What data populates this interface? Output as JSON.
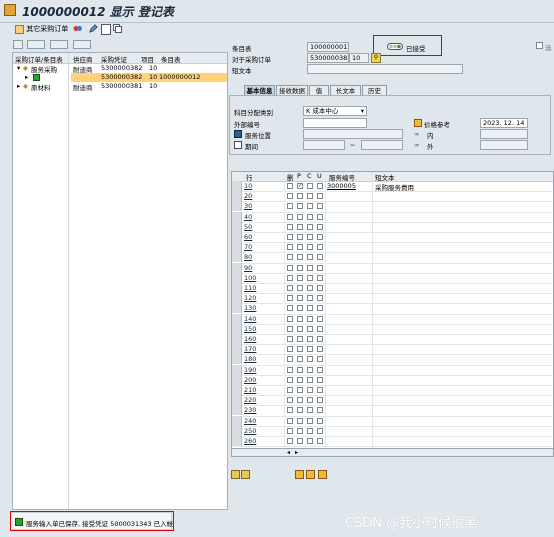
{
  "window": {
    "title": "1000000012 显示 登记表"
  },
  "toolbar": {
    "other_po_label": "其它采购订单"
  },
  "tree": {
    "columns": [
      "采购订单/条目表",
      "供应商",
      "采购凭证",
      "项目",
      "条目表"
    ],
    "rows": [
      {
        "label": "服务采购",
        "vendor": "耐迪商",
        "doc": "5300000382",
        "item": "10",
        "entry": "",
        "selected": false
      },
      {
        "label": "",
        "vendor": "",
        "doc": "5300000382",
        "item": "10",
        "entry": "1000000012",
        "selected": true
      },
      {
        "label": "原材料",
        "vendor": "耐迪商",
        "doc": "5300000381",
        "item": "10",
        "entry": "",
        "selected": false
      }
    ]
  },
  "header": {
    "entry_label": "条目表",
    "entry_value": "1000000012",
    "status_label": "已接受",
    "po_label": "对于采购订单",
    "po_value": "5300000382",
    "po_item": "10",
    "short_text_label": "短文本",
    "short_text_value": "",
    "right_edge_label": "选"
  },
  "tabs": [
    "基本信息",
    "接收数据",
    "值",
    "长文本",
    "历史"
  ],
  "basic": {
    "acct_label": "科目分配类别",
    "acct_value": "K 成本中心",
    "ext_no_label": "外部编号",
    "ext_no_value": "",
    "price_ref_label": "价格参考",
    "price_ref_value": "2023. 12. 14",
    "location_label": "服务位置",
    "location_value": "",
    "inner_label": "内",
    "period_label": "期间",
    "period_sep": "~",
    "outer_label": "外"
  },
  "grid": {
    "columns": [
      "行",
      "删",
      "P",
      "C",
      "U",
      "服务编号",
      "短文本"
    ],
    "rows": [
      {
        "line": "10",
        "service_no": "3000005",
        "text": "采购服务费用",
        "p": true
      },
      {
        "line": "20",
        "service_no": "",
        "text": "",
        "p": false
      },
      {
        "line": "30",
        "service_no": "",
        "text": "",
        "p": false
      },
      {
        "line": "40",
        "service_no": "",
        "text": "",
        "p": false
      },
      {
        "line": "50",
        "service_no": "",
        "text": "",
        "p": false
      },
      {
        "line": "60",
        "service_no": "",
        "text": "",
        "p": false
      },
      {
        "line": "70",
        "service_no": "",
        "text": "",
        "p": false
      },
      {
        "line": "80",
        "service_no": "",
        "text": "",
        "p": false
      },
      {
        "line": "90",
        "service_no": "",
        "text": "",
        "p": false
      },
      {
        "line": "100",
        "service_no": "",
        "text": "",
        "p": false
      },
      {
        "line": "110",
        "service_no": "",
        "text": "",
        "p": false
      },
      {
        "line": "120",
        "service_no": "",
        "text": "",
        "p": false
      },
      {
        "line": "130",
        "service_no": "",
        "text": "",
        "p": false
      },
      {
        "line": "140",
        "service_no": "",
        "text": "",
        "p": false
      },
      {
        "line": "150",
        "service_no": "",
        "text": "",
        "p": false
      },
      {
        "line": "160",
        "service_no": "",
        "text": "",
        "p": false
      },
      {
        "line": "170",
        "service_no": "",
        "text": "",
        "p": false
      },
      {
        "line": "180",
        "service_no": "",
        "text": "",
        "p": false
      },
      {
        "line": "190",
        "service_no": "",
        "text": "",
        "p": false
      },
      {
        "line": "200",
        "service_no": "",
        "text": "",
        "p": false
      },
      {
        "line": "210",
        "service_no": "",
        "text": "",
        "p": false
      },
      {
        "line": "220",
        "service_no": "",
        "text": "",
        "p": false
      },
      {
        "line": "230",
        "service_no": "",
        "text": "",
        "p": false
      },
      {
        "line": "240",
        "service_no": "",
        "text": "",
        "p": false
      },
      {
        "line": "250",
        "service_no": "",
        "text": "",
        "p": false
      },
      {
        "line": "260",
        "service_no": "",
        "text": "",
        "p": false
      }
    ]
  },
  "status_bar": {
    "message": "服务输入单已保存, 接受凭证 5000031343 已入帐"
  },
  "watermark": "CSDN @我小时候很黑",
  "colors": {
    "background": "#dfe6ec",
    "highlight_row": "#ffd27a",
    "annotation_red": "#e10000",
    "status_green": "#2f9e2f"
  }
}
